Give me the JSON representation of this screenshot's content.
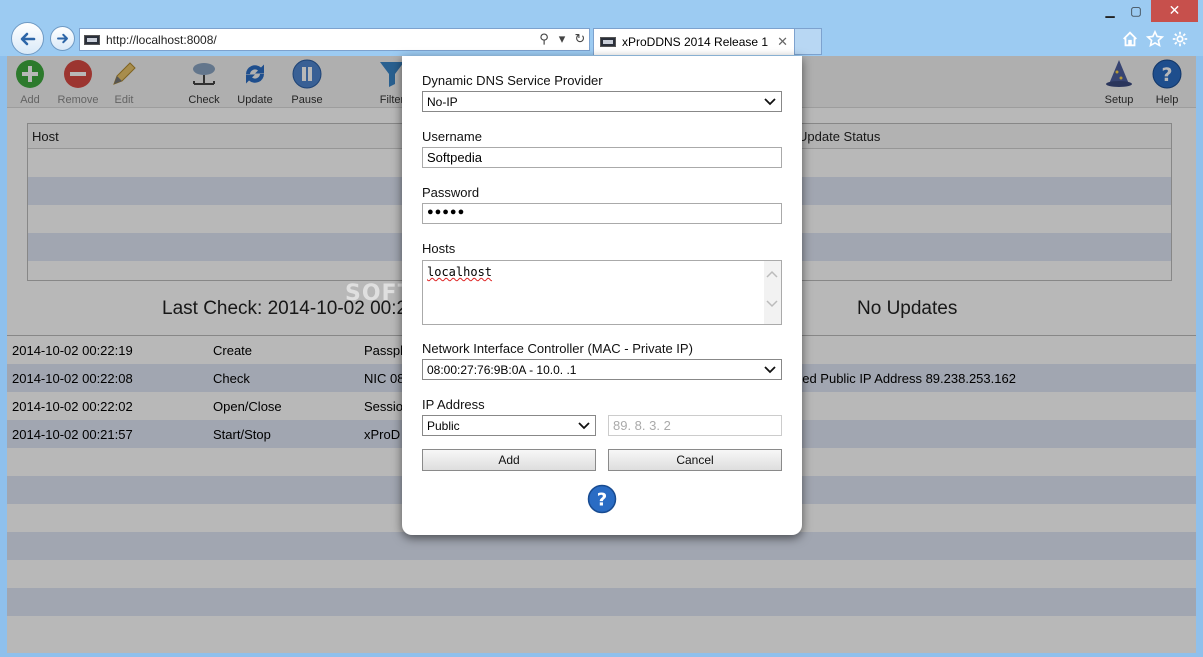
{
  "browser": {
    "url": "http://localhost:8008/",
    "tab_title": "xProDDNS 2014 Release 1",
    "tab_close": "✕",
    "win_min": "▁",
    "win_max": "▢",
    "win_close": "✕"
  },
  "toolbar": {
    "add": "Add",
    "remove": "Remove",
    "edit": "Edit",
    "check": "Check",
    "update": "Update",
    "pause": "Pause",
    "filter": "Filter",
    "setup": "Setup",
    "help": "Help"
  },
  "host_table": {
    "col_host": "Host",
    "col_update_status": "Update Status"
  },
  "status": {
    "last_check": "Last Check: 2014-10-02 00:22",
    "no_updates": "No Updates"
  },
  "log": [
    {
      "time": "2014-10-02 00:22:19",
      "type": "Create",
      "msg": "Passph",
      "msg2": ""
    },
    {
      "time": "2014-10-02 00:22:08",
      "type": "Check",
      "msg": "NIC 08",
      "msg2": "ned Public IP Address 89.238.253.162"
    },
    {
      "time": "2014-10-02 00:22:02",
      "type": "Open/Close",
      "msg": "Session",
      "msg2": ""
    },
    {
      "time": "2014-10-02 00:21:57",
      "type": "Start/Stop",
      "msg": "xProD",
      "msg2": ""
    }
  ],
  "watermark": "SOFT",
  "dialog": {
    "provider_label": "Dynamic DNS Service Provider",
    "provider_value": "No-IP",
    "username_label": "Username",
    "username_value": "Softpedia",
    "password_label": "Password",
    "password_value": "●●●●●",
    "hosts_label": "Hosts",
    "hosts_value": "localhost",
    "nic_label": "Network Interface Controller (MAC - Private IP)",
    "nic_value": "08:00:27:76:9B:0A - 10.0.  .1",
    "ip_label": "IP Address",
    "ip_mode": "Public",
    "ip_placeholder": "89.   8.   3.   2",
    "add_button": "Add",
    "cancel_button": "Cancel"
  },
  "colors": {
    "chrome": "#9ccbf2",
    "accent_blue": "#2a6cc4",
    "add_green": "#3faa3f",
    "remove_red": "#d94a43",
    "row_alt": "#dfe6f5"
  }
}
